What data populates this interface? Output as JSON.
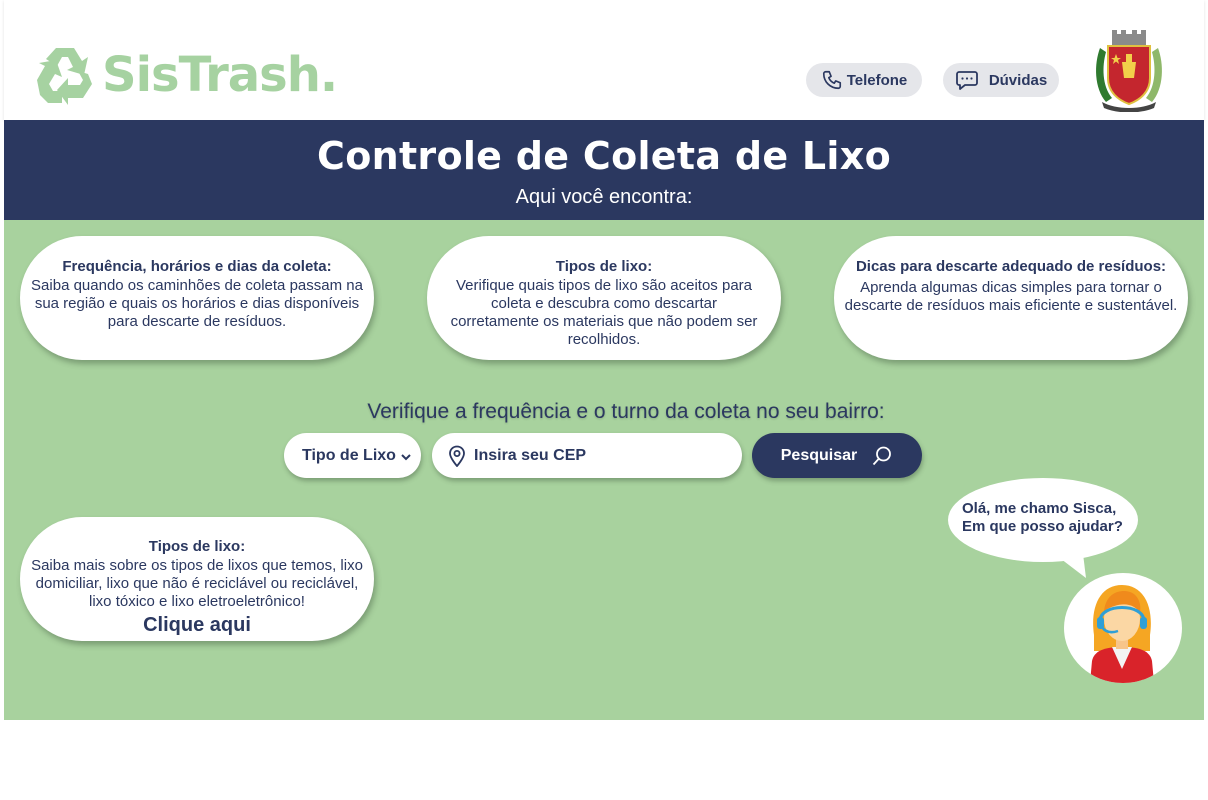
{
  "header": {
    "logo_text": "SisTrash.",
    "phone_label": "Telefone",
    "help_label": "Dúvidas"
  },
  "banner": {
    "title": "Controle de Coleta de Lixo",
    "subtitle": "Aqui você encontra:"
  },
  "cards": [
    {
      "title": "Frequência, horários e dias da coleta:",
      "body": "Saiba quando os caminhões de coleta passam na sua região e quais os horários e dias disponíveis para descarte de resíduos."
    },
    {
      "title": "Tipos de lixo:",
      "body": "Verifique quais tipos de lixo são aceitos para coleta e descubra como descartar corretamente os materiais que não podem ser recolhidos."
    },
    {
      "title": "Dicas para descarte adequado de resíduos:",
      "body": "Aprenda algumas dicas simples para tornar o descarte de resíduos mais eficiente e sustentável."
    },
    {
      "title": "Tipos de lixo:",
      "body": "Saiba mais sobre os tipos de lixos que temos, lixo domiciliar, lixo que não é reciclável ou reciclável, lixo tóxico e lixo eletroeletrônico!",
      "cta": "Clique aqui"
    }
  ],
  "search": {
    "heading": "Verifique a frequência e o turno da coleta no seu bairro:",
    "type_select": "Tipo de Lixo",
    "cep_placeholder": "Insira seu CEP",
    "submit_label": "Pesquisar"
  },
  "assistant": {
    "greeting_line1": "Olá, me chamo Sisca,",
    "greeting_line2": "Em que posso ajudar?"
  },
  "colors": {
    "navy": "#2b3860",
    "green_bg": "#a8d29e",
    "logo_green": "#a6d2a1",
    "pill_gray": "#e5e6ea"
  },
  "icons": [
    "recycle-icon",
    "phone-icon",
    "chat-icon",
    "chevron-down-icon",
    "location-pin-icon",
    "search-icon"
  ]
}
